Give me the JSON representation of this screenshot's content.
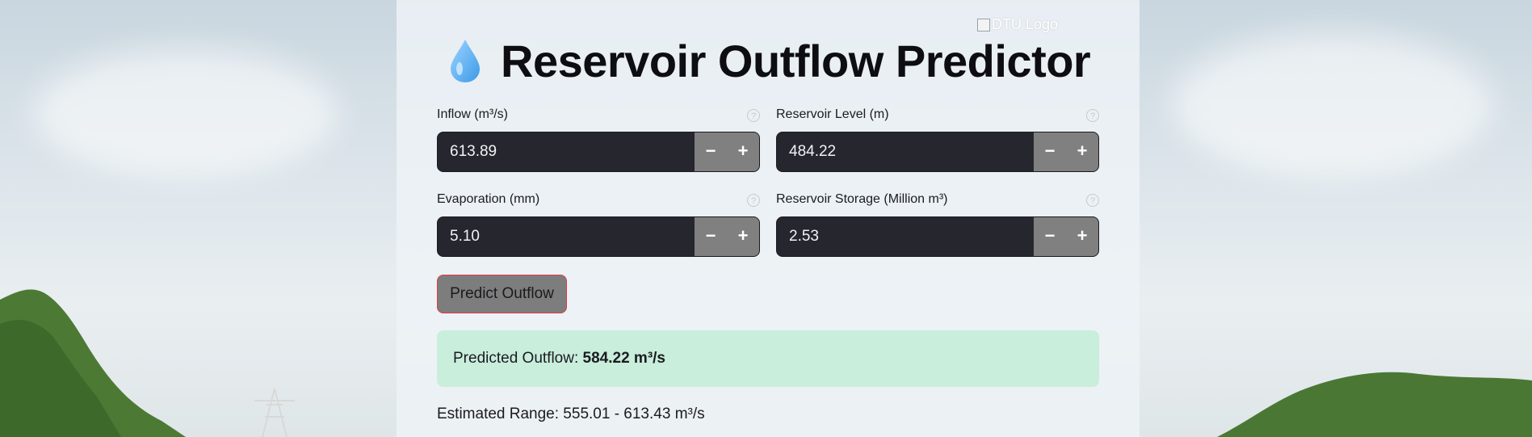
{
  "header": {
    "logo_alt": "DTU Logo",
    "title": "Reservoir Outflow Predictor",
    "title_icon": "water-drop-icon"
  },
  "form": {
    "inflow": {
      "label": "Inflow (m³/s)",
      "value": "613.89"
    },
    "reservoir_level": {
      "label": "Reservoir Level (m)",
      "value": "484.22"
    },
    "evaporation": {
      "label": "Evaporation (mm)",
      "value": "5.10"
    },
    "reservoir_storage": {
      "label": "Reservoir Storage (Million m³)",
      "value": "2.53"
    },
    "decrement_symbol": "−",
    "increment_symbol": "+",
    "help_symbol": "?"
  },
  "actions": {
    "predict_label": "Predict Outflow"
  },
  "result": {
    "label": "Predicted Outflow: ",
    "value": "584.22 m³/s",
    "range_text": "Estimated Range: 555.01 - 613.43 m³/s"
  },
  "colors": {
    "input_bg": "#26262f",
    "stepper_bg": "#808080",
    "button_border": "#e03d3d",
    "success_bg": "#c9eedb"
  }
}
